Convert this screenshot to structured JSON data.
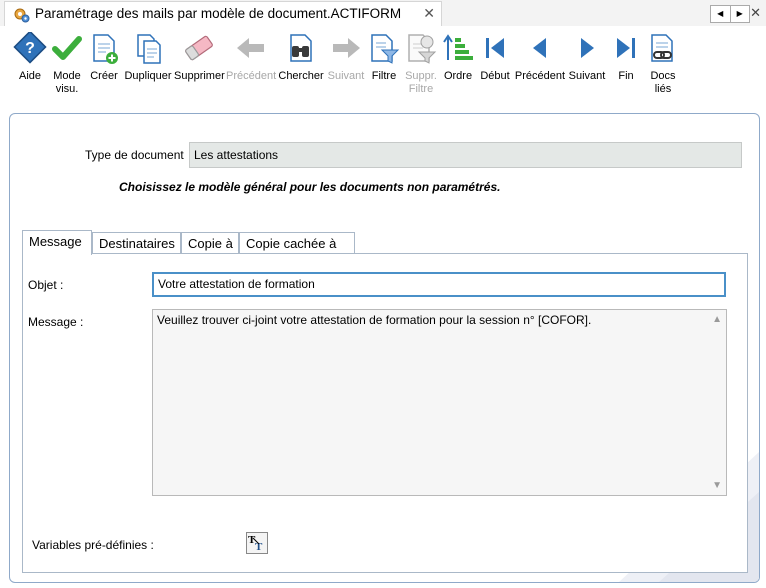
{
  "window": {
    "title": "Paramétrage des mails par modèle de document.ACTIFORM",
    "tab_close": "✕",
    "nav_prev": "◀",
    "nav_next": "▶",
    "window_close": "✕"
  },
  "toolbar": {
    "items": [
      {
        "label": "Aide",
        "icon": "help-icon",
        "enabled": true
      },
      {
        "label": "Mode\nvisu.",
        "icon": "checkmark-icon",
        "enabled": true
      },
      {
        "label": "Créer",
        "icon": "create-doc-icon",
        "enabled": true
      },
      {
        "label": "Dupliquer",
        "icon": "duplicate-icon",
        "enabled": true
      },
      {
        "label": "Supprimer",
        "icon": "eraser-icon",
        "enabled": true
      },
      {
        "label": "Précédent",
        "icon": "arrow-left-icon",
        "enabled": false
      },
      {
        "label": "Chercher",
        "icon": "binoculars-icon",
        "enabled": true
      },
      {
        "label": "Suivant",
        "icon": "arrow-right-icon",
        "enabled": false
      },
      {
        "label": "Filtre",
        "icon": "filter-icon",
        "enabled": true
      },
      {
        "label": "Suppr.\nFiltre",
        "icon": "remove-filter-icon",
        "enabled": false
      },
      {
        "label": "Ordre",
        "icon": "sort-order-icon",
        "enabled": true
      },
      {
        "label": "Début",
        "icon": "first-record-icon",
        "enabled": true
      },
      {
        "label": "Précédent",
        "icon": "previous-record-icon",
        "enabled": true
      },
      {
        "label": "Suivant",
        "icon": "next-record-icon",
        "enabled": true
      },
      {
        "label": "Fin",
        "icon": "last-record-icon",
        "enabled": true
      },
      {
        "label": "Docs\nliés",
        "icon": "linked-docs-icon",
        "enabled": true
      }
    ]
  },
  "form": {
    "type_label": "Type de document",
    "type_value": "Les attestations",
    "hint": "Choisissez le modèle général pour les documents non paramétrés.",
    "tabs": [
      "Message",
      "Destinataires",
      "Copie à",
      "Copie cachée à"
    ],
    "active_tab": "Message",
    "objet_label": "Objet :",
    "objet_value": "Votre attestation de formation",
    "message_label": "Message :",
    "message_value": "Veuillez trouver ci-joint votre attestation de formation pour la session n° [COFOR].",
    "variables_label": "Variables pré-définies :"
  },
  "colors": {
    "accent": "#1f6fb4",
    "check_green": "#3cae3c",
    "disabled_gray": "#a8a8a8",
    "panel_border": "#8fa9c9",
    "readonly_bg": "#e4e8e6"
  }
}
